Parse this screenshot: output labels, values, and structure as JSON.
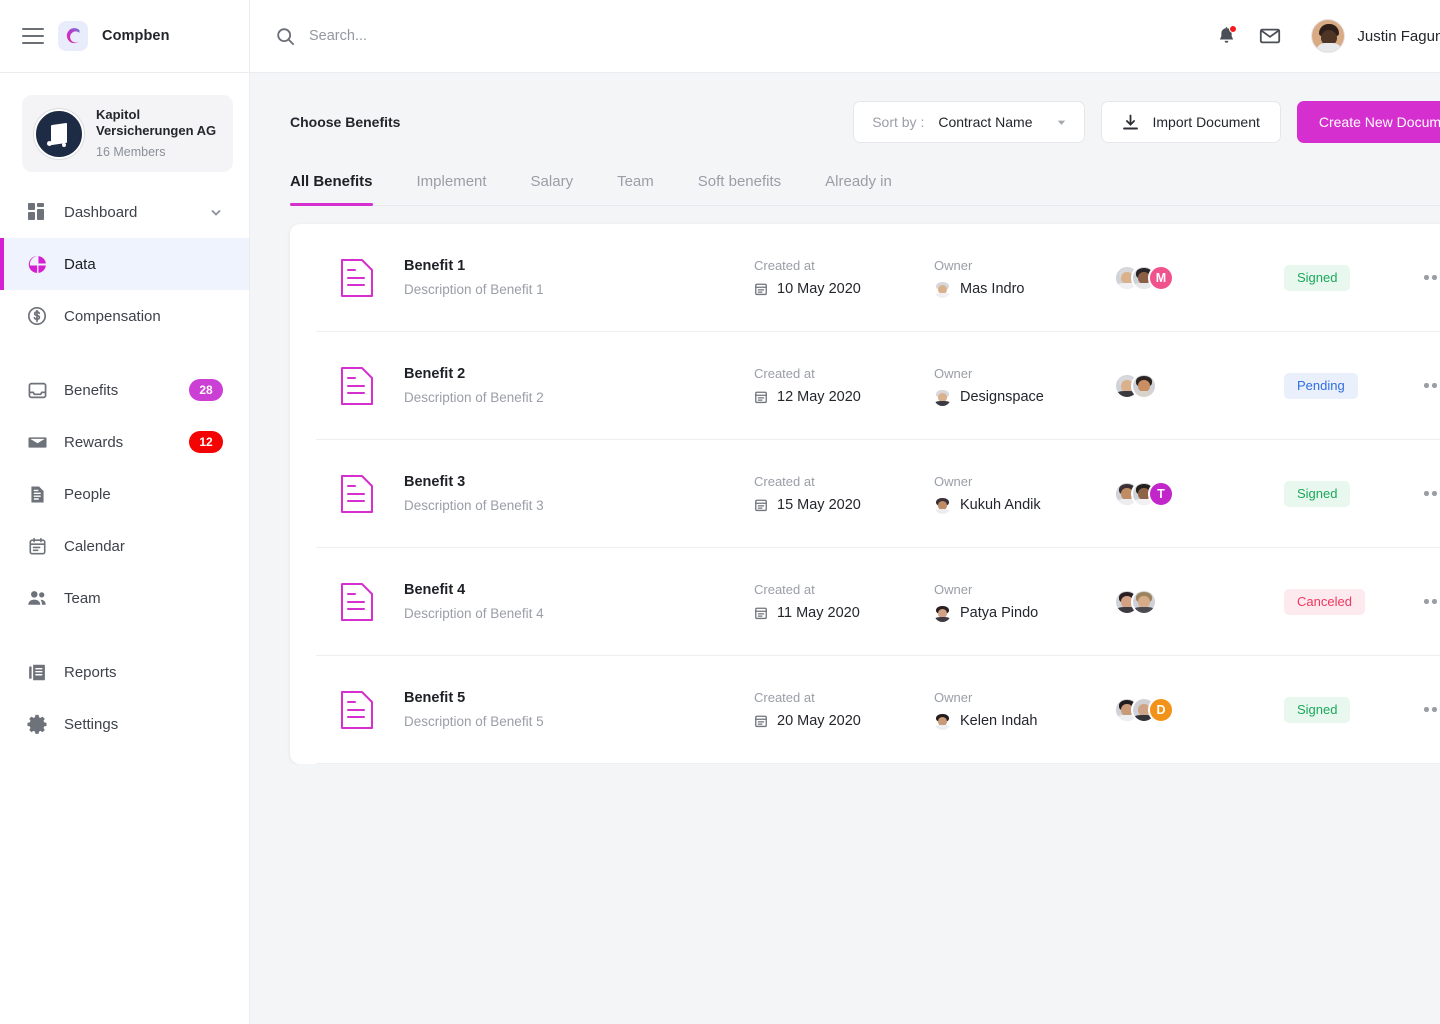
{
  "brand": {
    "name": "Compben",
    "logo_icon": "compben-c-logo",
    "menu_icon": "hamburger-icon"
  },
  "org": {
    "name": "Kapitol Versicherungen AG",
    "members": "16 Members",
    "avatar_icon": "org-avatar"
  },
  "sidebar": {
    "items": [
      {
        "label": "Dashboard",
        "icon": "dashboard-icon",
        "badge": null,
        "active": false,
        "chevron": true
      },
      {
        "label": "Data",
        "icon": "data-pie-icon",
        "badge": null,
        "active": true,
        "chevron": false
      },
      {
        "label": "Compensation",
        "icon": "dollar-circle-icon",
        "badge": null,
        "active": false,
        "chevron": false
      },
      {
        "label": "Benefits",
        "icon": "inbox-icon",
        "badge": "28",
        "badge_color": "#cc3fd4",
        "active": false,
        "chevron": false
      },
      {
        "label": "Rewards",
        "icon": "mail-icon",
        "badge": "12",
        "badge_color": "#f50303",
        "active": false,
        "chevron": false
      },
      {
        "label": "People",
        "icon": "people-doc-icon",
        "badge": null,
        "active": false,
        "chevron": false
      },
      {
        "label": "Calendar",
        "icon": "calendar-icon",
        "badge": null,
        "active": false,
        "chevron": false
      },
      {
        "label": "Team",
        "icon": "team-icon",
        "badge": null,
        "active": false,
        "chevron": false
      },
      {
        "label": "Reports",
        "icon": "reports-icon",
        "badge": null,
        "active": false,
        "chevron": false
      },
      {
        "label": "Settings",
        "icon": "gear-icon",
        "badge": null,
        "active": false,
        "chevron": false
      }
    ]
  },
  "topbar": {
    "search_placeholder": "Search...",
    "search_value": "",
    "search_icon": "search-icon",
    "notification_icon": "bell-icon",
    "has_notification": true,
    "mail_icon": "mail-icon",
    "user_name": "Justin Fagundez",
    "user_avatar_icon": "user-avatar",
    "caret_icon": "chevron-down-icon"
  },
  "toolbar": {
    "page_title": "Choose Benefits",
    "sort_label": "Sort by :",
    "sort_value": "Contract Name",
    "sort_caret_icon": "chevron-down-icon",
    "import_label": "Import Document",
    "import_icon": "download-icon",
    "create_label": "Create New Document",
    "accent_color": "#d62fd0"
  },
  "tabs": [
    {
      "label": "All Benefits",
      "active": true
    },
    {
      "label": "Implement",
      "active": false
    },
    {
      "label": "Salary",
      "active": false
    },
    {
      "label": "Team",
      "active": false
    },
    {
      "label": "Soft benefits",
      "active": false
    },
    {
      "label": "Already in",
      "active": false
    }
  ],
  "table": {
    "created_label": "Created at",
    "owner_label": "Owner",
    "doc_icon": "document-icon",
    "calendar_icon": "calendar-icon",
    "more_icon": "more-dots-icon",
    "rows": [
      {
        "title": "Benefit 1",
        "description": "Description of Benefit 1",
        "created_at": "10 May 2020",
        "owner": "Mas Indro",
        "team": [
          {
            "type": "photo",
            "hair": "#d8d8dc",
            "face": "#d9b28d",
            "body": "#f0f0f2"
          },
          {
            "type": "photo",
            "hair": "#2a2326",
            "face": "#8a5f45",
            "body": "#e7e8ea"
          },
          {
            "type": "letter",
            "initial": "M",
            "color": "#f0538c"
          }
        ],
        "status": {
          "label": "Signed",
          "kind": "signed"
        }
      },
      {
        "title": "Benefit 2",
        "description": "Description of Benefit 2",
        "created_at": "12 May 2020",
        "owner": "Designspace",
        "team": [
          {
            "type": "photo",
            "hair": "#d8d8dc",
            "face": "#d9b28d",
            "body": "#3a3a40"
          },
          {
            "type": "photo",
            "hair": "#2b2420",
            "face": "#c98f63",
            "body": "#d8d4cc"
          }
        ],
        "status": {
          "label": "Pending",
          "kind": "pending"
        }
      },
      {
        "title": "Benefit 3",
        "description": "Description of Benefit 3",
        "created_at": "15 May 2020",
        "owner": "Kukuh Andik",
        "team": [
          {
            "type": "photo",
            "hair": "#3a3036",
            "face": "#c08c64",
            "body": "#edecef"
          },
          {
            "type": "photo",
            "hair": "#24201e",
            "face": "#8d6348",
            "body": "#f1f1f3"
          },
          {
            "type": "letter",
            "initial": "T",
            "color": "#c225c9"
          }
        ],
        "status": {
          "label": "Signed",
          "kind": "signed"
        }
      },
      {
        "title": "Benefit 4",
        "description": "Description of Benefit 4",
        "created_at": "11 May 2020",
        "owner": "Patya Pindo",
        "team": [
          {
            "type": "photo",
            "hair": "#2a1f22",
            "face": "#d3a183",
            "body": "#3d3a42"
          },
          {
            "type": "photo",
            "hair": "#9d8460",
            "face": "#d7ac88",
            "body": "#4a4a50"
          }
        ],
        "status": {
          "label": "Canceled",
          "kind": "canceled"
        }
      },
      {
        "title": "Benefit 5",
        "description": "Description of Benefit 5",
        "created_at": "20 May 2020",
        "owner": "Kelen Indah",
        "team": [
          {
            "type": "photo",
            "hair": "#241c1e",
            "face": "#c89a77",
            "body": "#eceef0"
          },
          {
            "type": "photo",
            "hair": "#cfcfd4",
            "face": "#cfa385",
            "body": "#33333a"
          },
          {
            "type": "letter",
            "initial": "D",
            "color": "#f39219"
          }
        ],
        "status": {
          "label": "Signed",
          "kind": "signed"
        }
      }
    ]
  }
}
